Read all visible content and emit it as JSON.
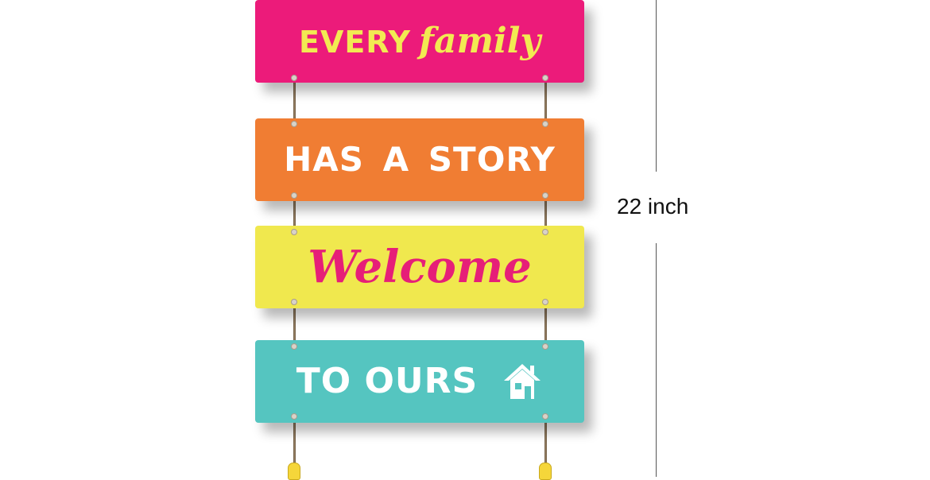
{
  "boards": [
    {
      "part1": "EVERY",
      "part2": "family",
      "color": "#ec1b7a",
      "text_color": "#f2ea52"
    },
    {
      "text": "HAS A STORY",
      "color": "#f07d33",
      "text_color": "#ffffff"
    },
    {
      "text": "Welcome",
      "color": "#f0e84e",
      "text_color": "#e61f78"
    },
    {
      "text": "TO OURS",
      "icon": "house-icon",
      "color": "#55c5c0",
      "text_color": "#ffffff"
    }
  ],
  "dimension": {
    "label": "22 inch"
  }
}
